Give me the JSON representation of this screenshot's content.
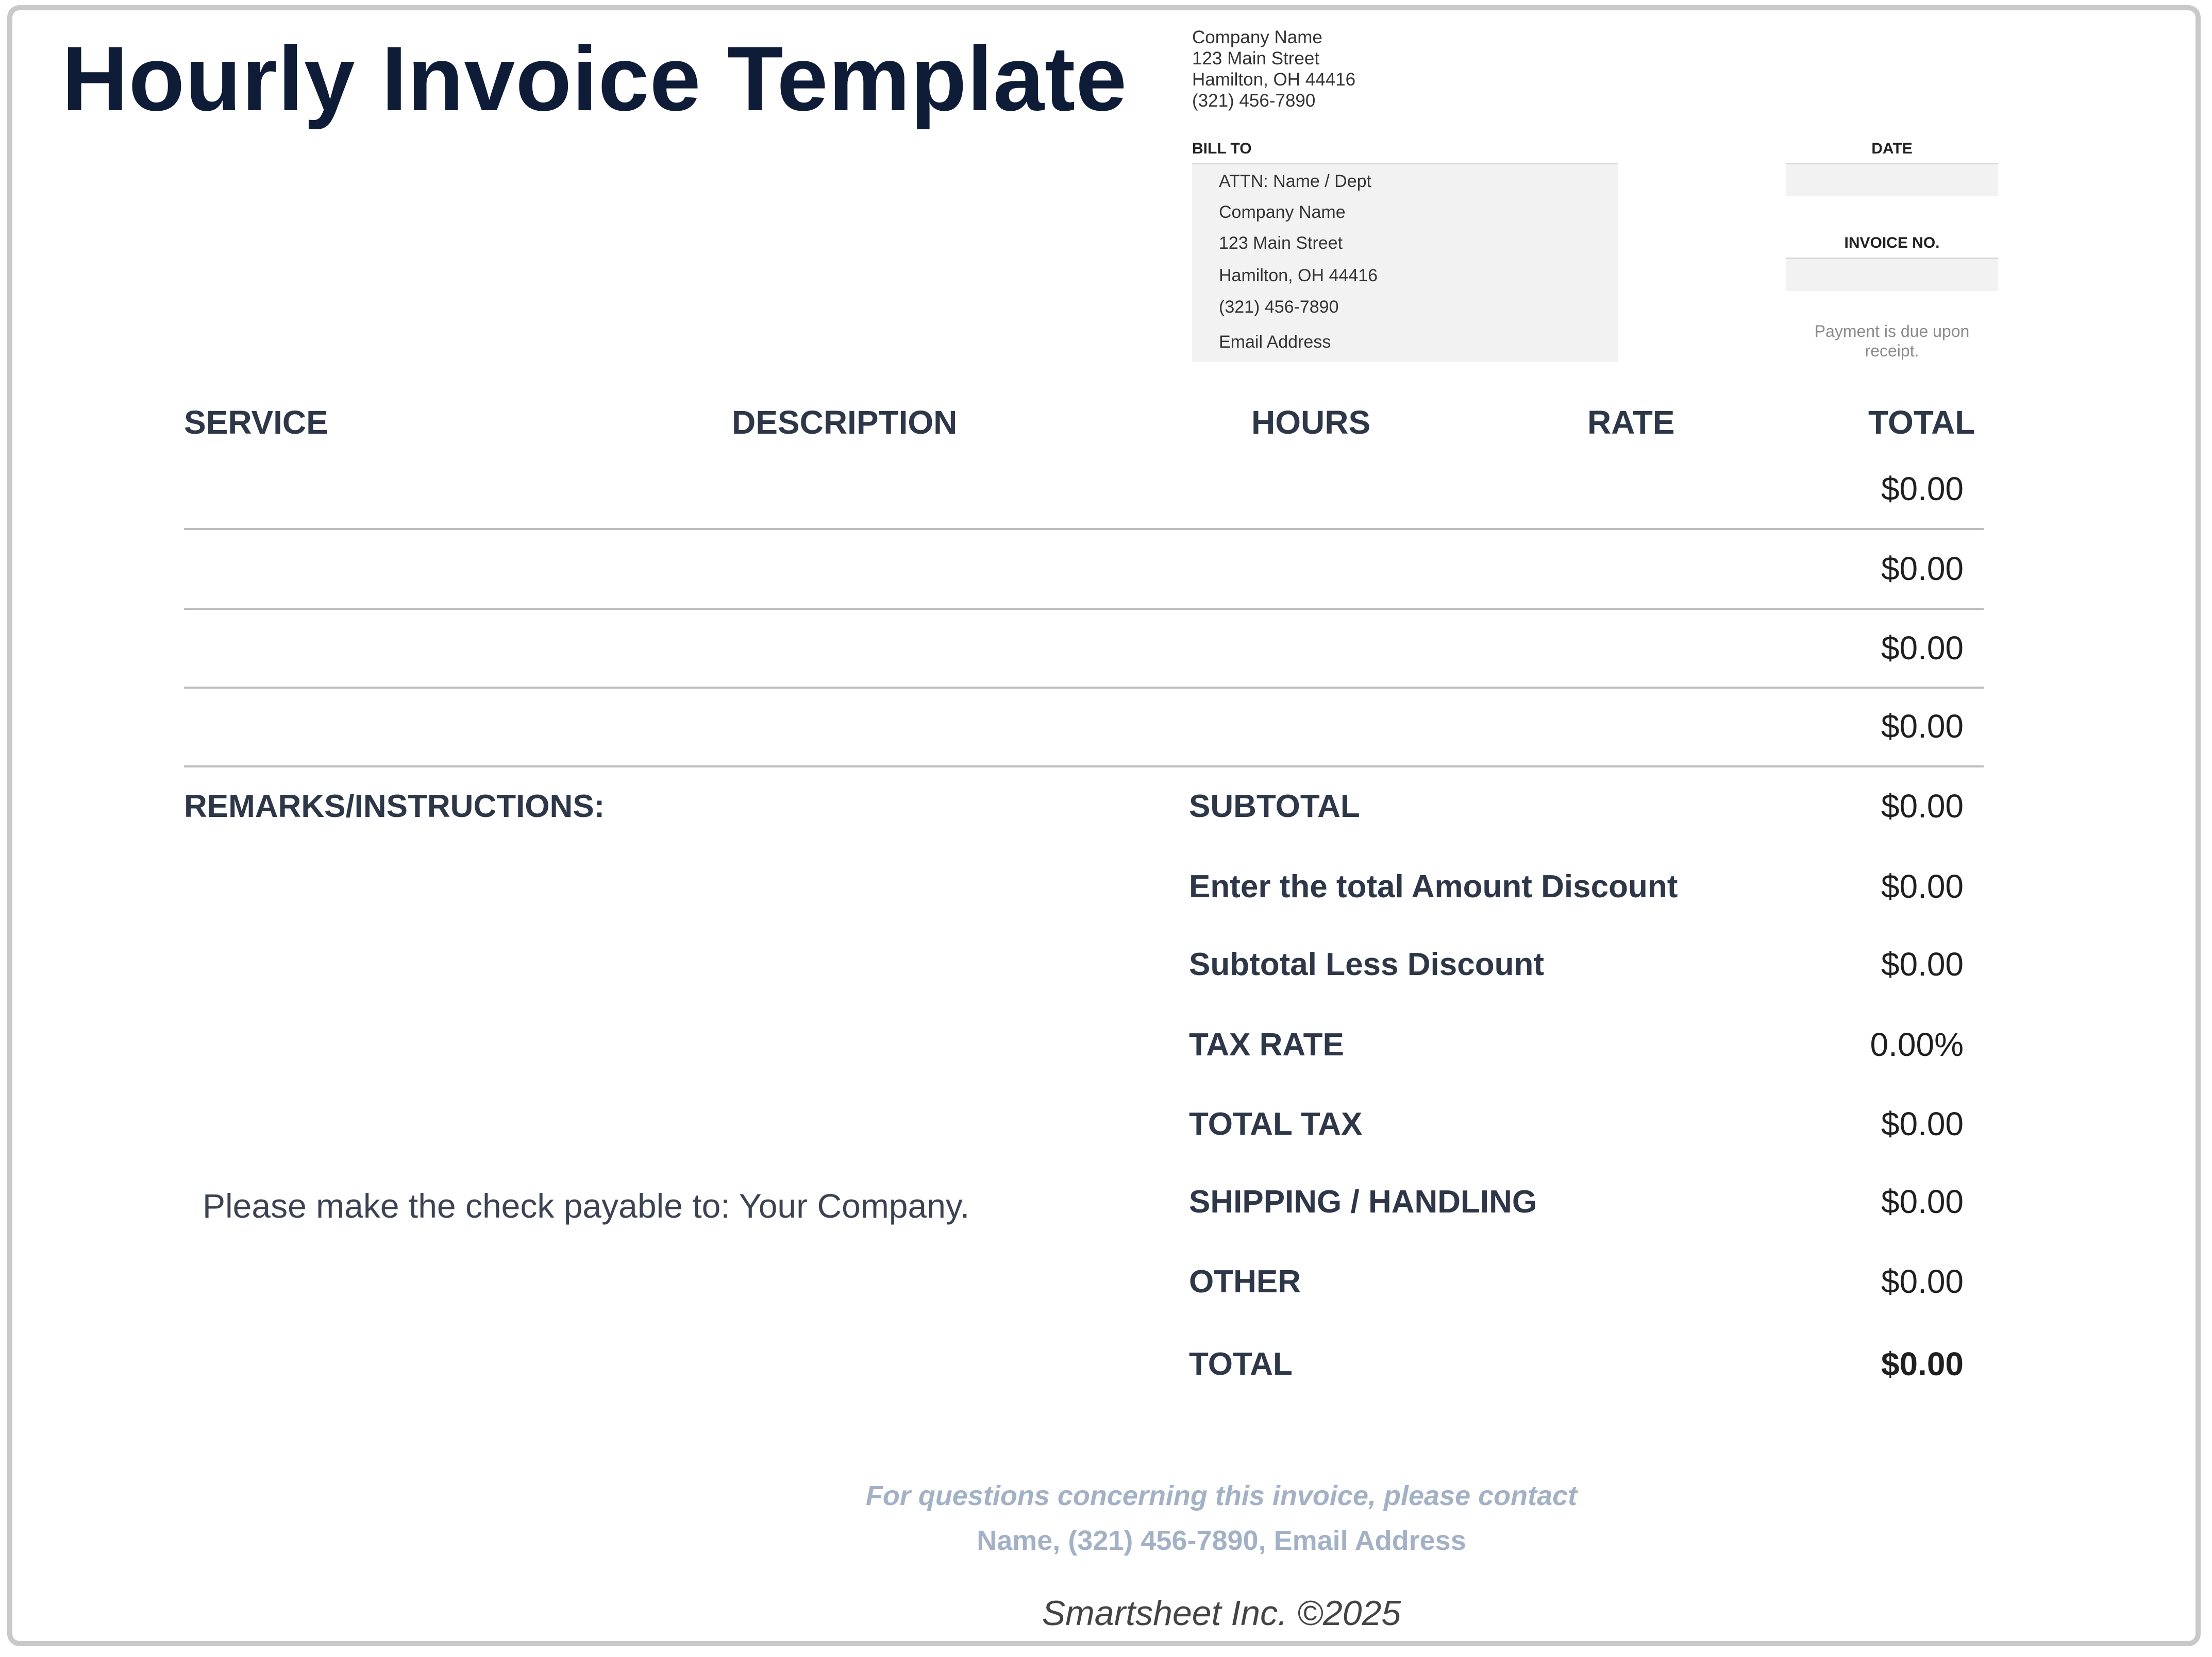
{
  "title": "Hourly Invoice Template",
  "company": {
    "name": "Company Name",
    "street": "123 Main Street",
    "city": "Hamilton, OH 44416",
    "phone": "(321) 456-7890"
  },
  "bill_to": {
    "label": "BILL TO",
    "lines": [
      "ATTN: Name / Dept",
      "Company Name",
      "123 Main Street",
      "Hamilton, OH  44416",
      "(321) 456-7890",
      "Email Address"
    ]
  },
  "date": {
    "label": "DATE",
    "value": ""
  },
  "invoice_no": {
    "label": "INVOICE NO.",
    "value": ""
  },
  "payment_note": "Payment is due upon receipt.",
  "table": {
    "headers": [
      "SERVICE",
      "DESCRIPTION",
      "HOURS",
      "RATE",
      "TOTAL"
    ],
    "rows": [
      {
        "service": "",
        "description": "",
        "hours": "",
        "rate": "",
        "total": "$0.00"
      },
      {
        "service": "",
        "description": "",
        "hours": "",
        "rate": "",
        "total": "$0.00"
      },
      {
        "service": "",
        "description": "",
        "hours": "",
        "rate": "",
        "total": "$0.00"
      },
      {
        "service": "",
        "description": "",
        "hours": "",
        "rate": "",
        "total": "$0.00"
      }
    ]
  },
  "remarks_label": "REMARKS/INSTRUCTIONS:",
  "payable_note": "Please make the check payable to: Your Company.",
  "summary": [
    {
      "label": "SUBTOTAL",
      "value": "$0.00"
    },
    {
      "label": "Enter the total Amount Discount",
      "value": "$0.00"
    },
    {
      "label": "Subtotal Less Discount",
      "value": "$0.00"
    },
    {
      "label": "TAX RATE",
      "value": "0.00%"
    },
    {
      "label": "TOTAL TAX",
      "value": "$0.00"
    },
    {
      "label": "SHIPPING / HANDLING",
      "value": "$0.00"
    },
    {
      "label": "OTHER",
      "value": "$0.00"
    },
    {
      "label": "TOTAL",
      "value": "$0.00"
    }
  ],
  "contact": {
    "line1": "For questions concerning this invoice, please contact",
    "line2": "Name, (321) 456-7890, Email Address"
  },
  "footer": "Smartsheet Inc. ©2025"
}
